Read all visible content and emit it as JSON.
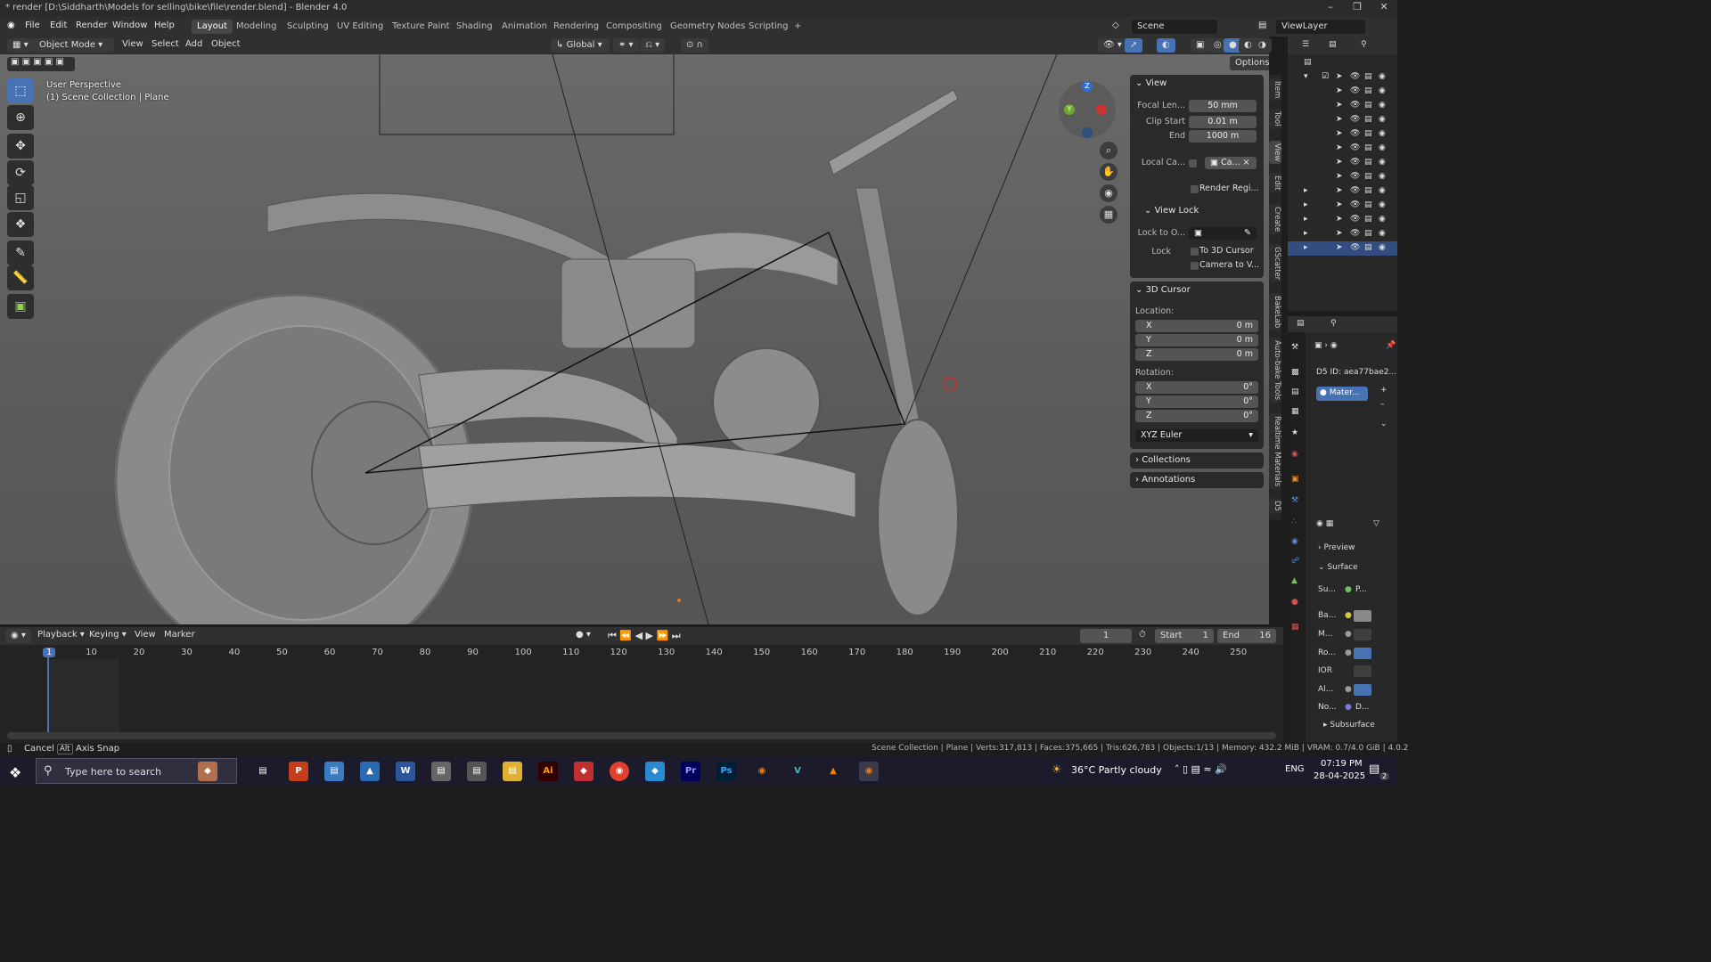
{
  "window": {
    "title": "* render [D:\\Siddharth\\Models for selling\\bike\\file\\render.blend] - Blender 4.0",
    "minimize_icon": "minimize-icon",
    "maximize_icon": "maximize-icon",
    "close_icon": "close-icon"
  },
  "topbar": {
    "menus": [
      "File",
      "Edit",
      "Render",
      "Window",
      "Help"
    ],
    "workspaces": [
      "Layout",
      "Modeling",
      "Sculpting",
      "UV Editing",
      "Texture Paint",
      "Shading",
      "Animation",
      "Rendering",
      "Compositing",
      "Geometry Nodes",
      "Scripting"
    ],
    "active_workspace": "Layout",
    "add_workspace": "+",
    "scene": "Scene",
    "view_layer": "ViewLayer"
  },
  "viewport_header": {
    "mode": "Object Mode",
    "menus": [
      "View",
      "Select",
      "Add",
      "Object"
    ],
    "transform_orientation": "Global",
    "options": "Options"
  },
  "viewport": {
    "perspective": "User Perspective",
    "collection": "(1) Scene Collection | Plane",
    "gizmo_axes": [
      "Z",
      "Y",
      "X"
    ]
  },
  "npanel": {
    "view": {
      "header": "View",
      "focal_length_label": "Focal Len...",
      "focal_length": "50 mm",
      "clip_start_label": "Clip Start",
      "clip_start": "0.01 m",
      "clip_end_label": "End",
      "clip_end": "1000 m",
      "local_camera_label": "Local Ca...",
      "local_camera_value": "Ca...",
      "render_region_label": "Render Regi...",
      "view_lock_header": "View Lock",
      "lock_to_object_label": "Lock to O...",
      "lock_label": "Lock",
      "to_3d_cursor": "To 3D Cursor",
      "camera_to_view": "Camera to V..."
    },
    "cursor": {
      "header": "3D Cursor",
      "location_label": "Location:",
      "loc_x": "0 m",
      "loc_y": "0 m",
      "loc_z": "0 m",
      "rotation_label": "Rotation:",
      "rot_x": "0°",
      "rot_y": "0°",
      "rot_z": "0°",
      "rotation_mode": "XYZ Euler",
      "axis_x": "X",
      "axis_y": "Y",
      "axis_z": "Z"
    },
    "collections": "Collections",
    "annotations": "Annotations"
  },
  "vertical_tabs": [
    "Item",
    "Tool",
    "View",
    "Edit",
    "Create",
    "GScatter",
    "BakeLab",
    "Auto-bake Tools",
    "Realtime Materials",
    "D5"
  ],
  "properties": {
    "d5_id": "D5 ID: aea77bae2...",
    "material_slot": "Mater...",
    "preview": "Preview",
    "surface": "Surface",
    "rows": [
      {
        "label": "Su...",
        "value": "P..."
      },
      {
        "label": "Ba...",
        "value": ""
      },
      {
        "label": "M...",
        "value": ""
      },
      {
        "label": "Ro...",
        "value": ""
      },
      {
        "label": "IOR",
        "value": ""
      },
      {
        "label": "Al...",
        "value": ""
      },
      {
        "label": "No...",
        "value": "D..."
      }
    ],
    "subsurface": "Subsurface"
  },
  "timeline": {
    "menus": [
      "Playback",
      "Keying",
      "View",
      "Marker"
    ],
    "current_frame": "1",
    "start_label": "Start",
    "start": "1",
    "end_label": "End",
    "end": "16",
    "ticks": [
      "1",
      "10",
      "20",
      "30",
      "40",
      "50",
      "60",
      "70",
      "80",
      "90",
      "100",
      "110",
      "120",
      "130",
      "140",
      "150",
      "160",
      "170",
      "180",
      "190",
      "200",
      "210",
      "220",
      "230",
      "240",
      "250"
    ]
  },
  "statusbar": {
    "cancel": "Cancel",
    "alt_key": "Alt",
    "axis_snap": "Axis Snap",
    "stats": "Scene Collection | Plane | Verts:317,813 | Faces:375,665 | Tris:626,783 | Objects:1/13 | Memory: 432.2 MiB | VRAM: 0.7/4.0 GiB | 4.0.2"
  },
  "taskbar": {
    "search_placeholder": "Type here to search",
    "weather": "36°C  Partly cloudy",
    "language": "ENG",
    "time": "07:19 PM",
    "date": "28-04-2025",
    "notification_count": "2"
  },
  "colors": {
    "accent": "#4772b3",
    "selected_row": "#334d80",
    "timeline_playhead": "#4772b3",
    "viewport_bg": "#606060"
  }
}
